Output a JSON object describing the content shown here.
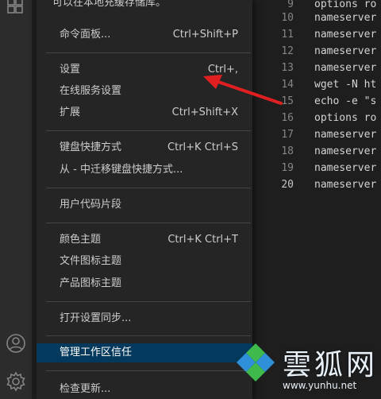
{
  "menu": {
    "partial_top_label": "可以在本地充缓存储库。",
    "items": [
      {
        "label": "命令面板...",
        "shortcut": "Ctrl+Shift+P"
      },
      {
        "label": "设置",
        "shortcut": "Ctrl+,"
      },
      {
        "label": "在线服务设置",
        "shortcut": ""
      },
      {
        "label": "扩展",
        "shortcut": "Ctrl+Shift+X"
      },
      {
        "label": "键盘快捷方式",
        "shortcut": "Ctrl+K Ctrl+S"
      },
      {
        "label": "从 - 中迁移键盘快捷方式...",
        "shortcut": ""
      },
      {
        "label": "用户代码片段",
        "shortcut": ""
      },
      {
        "label": "颜色主题",
        "shortcut": "Ctrl+K Ctrl+T"
      },
      {
        "label": "文件图标主题",
        "shortcut": ""
      },
      {
        "label": "产品图标主题",
        "shortcut": ""
      },
      {
        "label": "打开设置同步...",
        "shortcut": ""
      },
      {
        "label": "管理工作区信任",
        "shortcut": ""
      },
      {
        "label": "检查更新...",
        "shortcut": ""
      }
    ],
    "active_index": 11
  },
  "editor": {
    "lines": [
      {
        "n": "9",
        "text": "options ro"
      },
      {
        "n": "10",
        "text": "nameserver"
      },
      {
        "n": "11",
        "text": "nameserver"
      },
      {
        "n": "12",
        "text": "nameserver"
      },
      {
        "n": "13",
        "text": "nameserver"
      },
      {
        "n": "14",
        "text": "wget -N ht"
      },
      {
        "n": "15",
        "text": "echo -e \"s"
      },
      {
        "n": "16",
        "text": "options ro"
      },
      {
        "n": "17",
        "text": "nameserver"
      },
      {
        "n": "18",
        "text": "nameserver"
      },
      {
        "n": "19",
        "text": "nameserver"
      },
      {
        "n": "20",
        "text": "nameserver"
      }
    ],
    "current_line": "20"
  },
  "activity": {
    "icons": [
      "extensions-icon",
      "account-icon",
      "settings-gear-icon"
    ]
  },
  "watermark": {
    "title": "雲狐网",
    "url": "www.yunhu.net"
  },
  "colors": {
    "menu_bg": "#252526",
    "active_item": "#04395e",
    "arrow": "#e02020",
    "editor_bg": "#1e1e1e"
  }
}
